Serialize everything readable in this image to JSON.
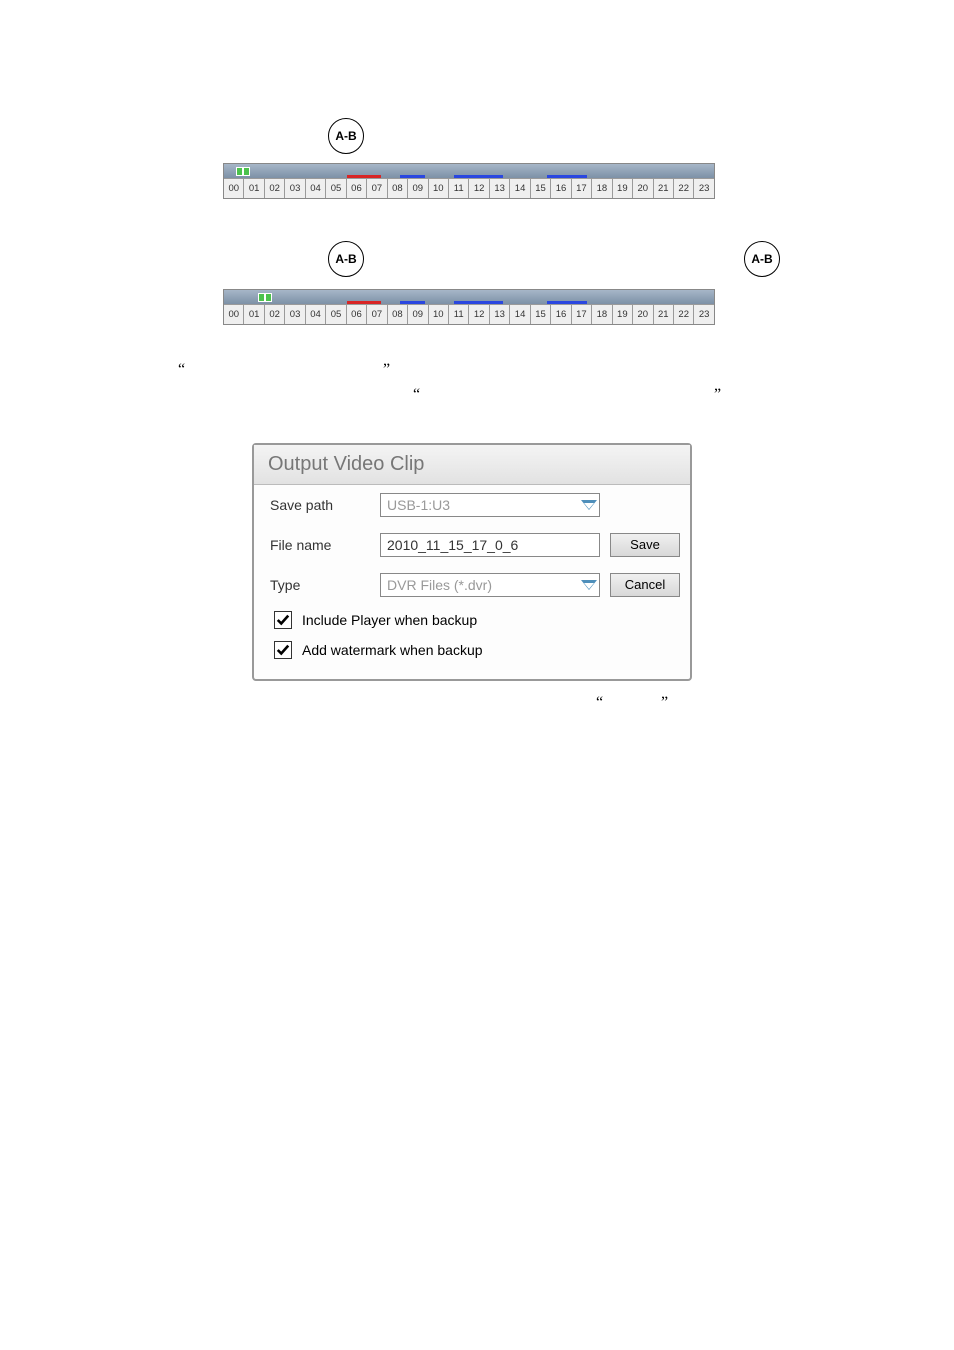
{
  "ab_label": "A-B",
  "timeline": {
    "hours": [
      "00",
      "01",
      "02",
      "03",
      "04",
      "05",
      "06",
      "07",
      "08",
      "09",
      "10",
      "11",
      "12",
      "13",
      "14",
      "15",
      "16",
      "17",
      "18",
      "19",
      "20",
      "21",
      "22",
      "23"
    ]
  },
  "timeline1": {
    "handle_left_pct": 2.5,
    "red": {
      "left_pct": 25,
      "width_pct": 7
    },
    "blues": [
      {
        "left_pct": 36,
        "width_pct": 5
      },
      {
        "left_pct": 47,
        "width_pct": 10
      },
      {
        "left_pct": 66,
        "width_pct": 8
      }
    ]
  },
  "timeline2": {
    "handle_left_pct": 7,
    "red": {
      "left_pct": 25,
      "width_pct": 7
    },
    "blues": [
      {
        "left_pct": 36,
        "width_pct": 5
      },
      {
        "left_pct": 47,
        "width_pct": 10
      },
      {
        "left_pct": 66,
        "width_pct": 8
      }
    ]
  },
  "quotes": {
    "q1a": "“",
    "q1b": "”",
    "q2a": "“",
    "q2b": "”",
    "q3a": "“",
    "q3b": "”"
  },
  "dialog": {
    "title": "Output Video Clip",
    "rows": {
      "save_path_label": "Save path",
      "save_path_value": "USB-1:U3",
      "file_name_label": "File name",
      "file_name_value": "2010_11_15_17_0_6",
      "type_label": "Type",
      "type_value": "DVR Files (*.dvr)"
    },
    "buttons": {
      "save": "Save",
      "cancel": "Cancel"
    },
    "checkboxes": {
      "include_player": "Include Player when backup",
      "add_watermark": "Add watermark when backup"
    }
  }
}
